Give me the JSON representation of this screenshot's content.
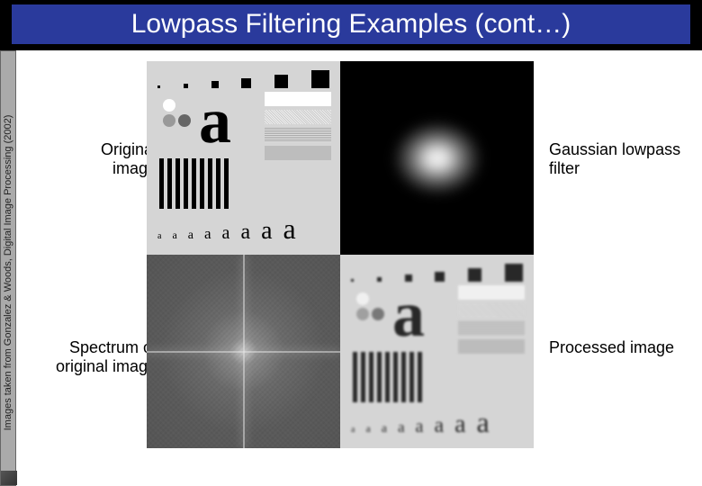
{
  "title": "Lowpass Filtering Examples (cont…)",
  "credit": "Images taken from Gonzalez & Woods, Digital Image Processing (2002)",
  "labels": {
    "tl": "Original image",
    "tr": "Gaussian lowpass filter",
    "bl": "Spectrum of original image",
    "br": "Processed image"
  },
  "a_row": "a a a a a a a a",
  "big_a": "a"
}
